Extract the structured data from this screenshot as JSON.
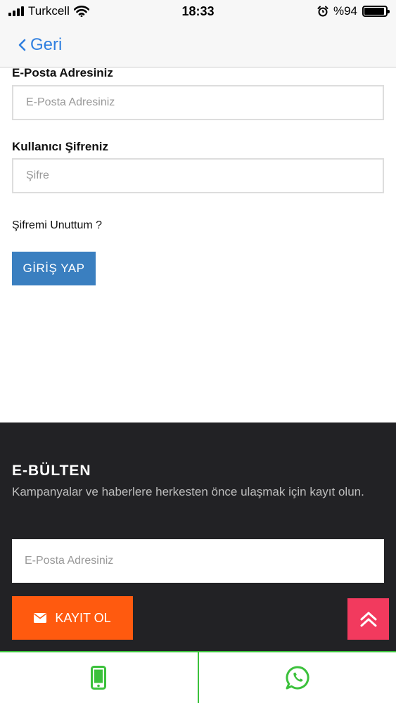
{
  "status_bar": {
    "carrier": "Turkcell",
    "time": "18:33",
    "battery_text": "%94",
    "battery_level": 0.94
  },
  "nav": {
    "back_label": "Geri"
  },
  "login": {
    "email_label": "E-Posta Adresiniz",
    "email_placeholder": "E-Posta Adresiniz",
    "password_label": "Kullanıcı Şifreniz",
    "password_placeholder": "Şifre",
    "forgot_link": "Şifremi Unuttum ?",
    "submit_label": "GİRİŞ YAP"
  },
  "newsletter": {
    "title": "E-BÜLTEN",
    "description": "Kampanyalar ve haberlere herkesten önce ulaşmak için kayıt olun.",
    "email_placeholder": "E-Posta Adresiniz",
    "subscribe_label": "KAYIT OL"
  },
  "icons": {
    "back": "chevron-left-icon",
    "subscribe": "envelope-icon",
    "scroll_top": "double-chevron-up-icon",
    "phone": "phone-icon",
    "whatsapp": "whatsapp-icon"
  },
  "colors": {
    "link_blue": "#2f7fe0",
    "login_button": "#3a7fc0",
    "newsletter_bg": "#222225",
    "subscribe_orange": "#ff5a0f",
    "scroll_top_pink": "#f23a5e",
    "contact_green": "#3cc13c"
  }
}
